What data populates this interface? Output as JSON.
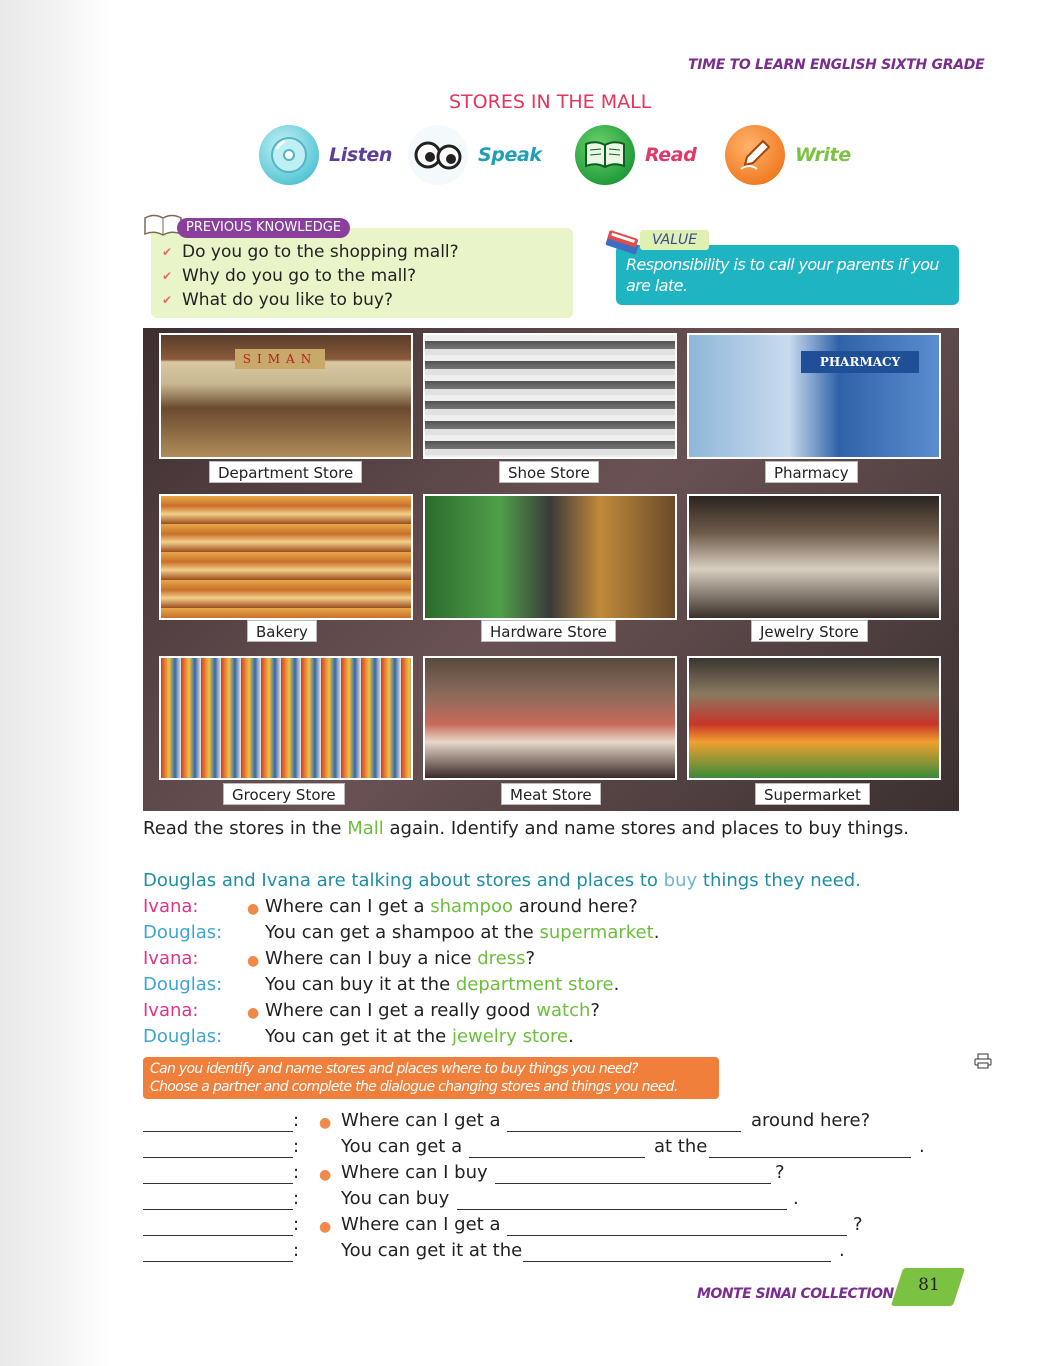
{
  "header": {
    "series_title": "TIME TO LEARN ENGLISH SIXTH GRADE",
    "unit_title": "STORES IN THE MALL"
  },
  "skills": [
    {
      "label": "Listen",
      "color": "#5b3f9b",
      "icon": "cd-icon"
    },
    {
      "label": "Speak",
      "color": "#1f9fb5",
      "icon": "eyes-icon"
    },
    {
      "label": "Read",
      "color": "#e0386b",
      "icon": "book-icon"
    },
    {
      "label": "Write",
      "color": "#7cc242",
      "icon": "pencil-icon"
    }
  ],
  "previous_knowledge": {
    "tag": "PREVIOUS KNOWLEDGE",
    "items": [
      "Do you go to the shopping mall?",
      "Why do you go to the mall?",
      "What do you like to buy?"
    ]
  },
  "value": {
    "tag": "VALUE",
    "text": "Responsibility is to call your parents if you are late."
  },
  "stores": [
    {
      "caption": "Department Store"
    },
    {
      "caption": "Shoe Store"
    },
    {
      "caption": "Pharmacy"
    },
    {
      "caption": "Bakery"
    },
    {
      "caption": "Hardware Store"
    },
    {
      "caption": "Jewelry Store"
    },
    {
      "caption": "Grocery Store"
    },
    {
      "caption": "Meat Store"
    },
    {
      "caption": "Supermarket"
    }
  ],
  "photo_sign_pharmacy": "PHARMACY",
  "photo_sign_department": "SIMAN",
  "instruction": {
    "before": "Read the stores in the ",
    "highlight": "Mall",
    "after": " again. Identify and name stores and places to buy things."
  },
  "dialogue_intro": {
    "before": "Douglas and Ivana are talking about stores and places to ",
    "highlight": "buy",
    "after": " things they need."
  },
  "dialogue": [
    {
      "speaker": "Ivana:",
      "bullet": true,
      "before": "Where can I get a ",
      "highlight": "shampoo",
      "after": " around here?"
    },
    {
      "speaker": "Douglas:",
      "bullet": false,
      "before": "You can get a shampoo at the ",
      "highlight": "supermarket",
      "after": "."
    },
    {
      "speaker": "Ivana:",
      "bullet": true,
      "before": "Where can I buy a nice ",
      "highlight": "dress",
      "after": "?"
    },
    {
      "speaker": "Douglas:",
      "bullet": false,
      "before": "You can buy it at the ",
      "highlight": "department store",
      "after": "."
    },
    {
      "speaker": "Ivana:",
      "bullet": true,
      "before": "Where can I get a really good ",
      "highlight": "watch",
      "after": "?"
    },
    {
      "speaker": "Douglas:",
      "bullet": false,
      "before": "You can get it at the ",
      "highlight": "jewelry store",
      "after": "."
    }
  ],
  "task": {
    "line1": "Can you identify and name stores and places where to buy things you need?",
    "line2": "Choose a partner and complete the dialogue changing stores and things you need."
  },
  "exercise": {
    "colon": ":",
    "q1_a": "Where can I get a",
    "q1_b": "around here?",
    "a1_a": "You can get a",
    "a1_b": "at the",
    "a1_end": ".",
    "q2_a": "Where can I buy",
    "q2_end": "?",
    "a2_a": "You can buy",
    "a2_end": ".",
    "q3_a": "Where can I get a",
    "q3_end": "?",
    "a3_a": "You can get it at the",
    "a3_end": "."
  },
  "footer": {
    "collection": "MONTE SINAI COLLECTION",
    "page_number": "81"
  },
  "colors": {
    "accent_purple": "#7a2d8f",
    "title_red": "#e8335b",
    "value_teal": "#1fb4c2",
    "task_orange": "#f07f3c",
    "highlight_green": "#6cbf3c"
  }
}
